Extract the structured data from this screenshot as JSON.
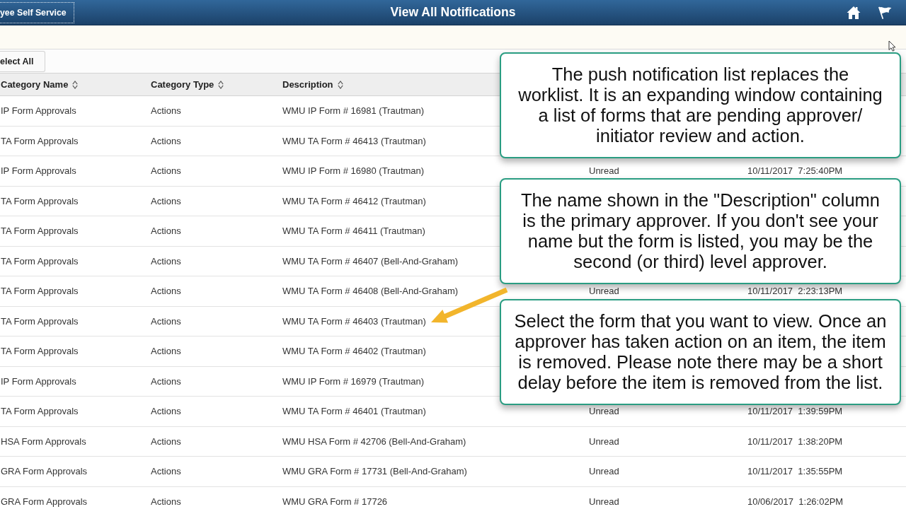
{
  "header": {
    "back_button": "yee Self Service",
    "title": "View All Notifications"
  },
  "toolbar": {
    "select_all_button": "elect All"
  },
  "table": {
    "columns": [
      {
        "label": "Category Name",
        "sortable": true
      },
      {
        "label": "Category Type",
        "sortable": true
      },
      {
        "label": "Description",
        "sortable": true
      }
    ],
    "rows": [
      {
        "category_name": "IP Form Approvals",
        "category_type": "Actions",
        "description": "WMU IP Form # 16981 (Trautman)"
      },
      {
        "category_name": "TA Form Approvals",
        "category_type": "Actions",
        "description": "WMU TA Form # 46413 (Trautman)"
      },
      {
        "category_name": "IP Form Approvals",
        "category_type": "Actions",
        "description": "WMU IP Form # 16980 (Trautman)",
        "status": "Unread",
        "date": "10/11/2017  7:25:40PM"
      },
      {
        "category_name": "TA Form Approvals",
        "category_type": "Actions",
        "description": "WMU TA Form # 46412 (Trautman)"
      },
      {
        "category_name": "TA Form Approvals",
        "category_type": "Actions",
        "description": "WMU TA Form # 46411 (Trautman)"
      },
      {
        "category_name": "TA Form Approvals",
        "category_type": "Actions",
        "description": "WMU TA Form # 46407 (Bell-And-Graham)"
      },
      {
        "category_name": "TA Form Approvals",
        "category_type": "Actions",
        "description": "WMU TA Form # 46408 (Bell-And-Graham)",
        "status": "Unread",
        "date": "10/11/2017  2:23:13PM"
      },
      {
        "category_name": "TA Form Approvals",
        "category_type": "Actions",
        "description": "WMU TA Form # 46403 (Trautman)"
      },
      {
        "category_name": "TA Form Approvals",
        "category_type": "Actions",
        "description": "WMU TA Form # 46402 (Trautman)"
      },
      {
        "category_name": "IP Form Approvals",
        "category_type": "Actions",
        "description": "WMU IP Form # 16979 (Trautman)"
      },
      {
        "category_name": "TA Form Approvals",
        "category_type": "Actions",
        "description": "WMU TA Form # 46401 (Trautman)",
        "status": "Unread",
        "date": "10/11/2017  1:39:59PM"
      },
      {
        "category_name": "HSA Form Approvals",
        "category_type": "Actions",
        "description": "WMU HSA Form # 42706 (Bell-And-Graham)",
        "status": "Unread",
        "date": "10/11/2017  1:38:20PM"
      },
      {
        "category_name": "GRA Form Approvals",
        "category_type": "Actions",
        "description": "WMU GRA Form # 17731 (Bell-And-Graham)",
        "status": "Unread",
        "date": "10/11/2017  1:35:55PM"
      },
      {
        "category_name": "GRA Form Approvals",
        "category_type": "Actions",
        "description": "WMU GRA Form # 17726",
        "status": "Unread",
        "date": "10/06/2017  1:26:02PM"
      }
    ]
  },
  "callouts": [
    {
      "lines": [
        "The push notification list replaces the",
        "worklist. It is an expanding window containing",
        "a list of forms that are pending approver/",
        "initiator review and action."
      ]
    },
    {
      "lines": [
        "The name shown in the \"Description\" column",
        "is the primary approver. If you don't see your",
        "name but the form is listed, you may be the",
        "second (or third) level approver."
      ]
    },
    {
      "lines": [
        "Select the form that you want to view. Once an",
        "approver has taken action on an item, the item",
        "is removed. Please note there may be a short",
        "delay before the item is removed from the list."
      ]
    }
  ]
}
